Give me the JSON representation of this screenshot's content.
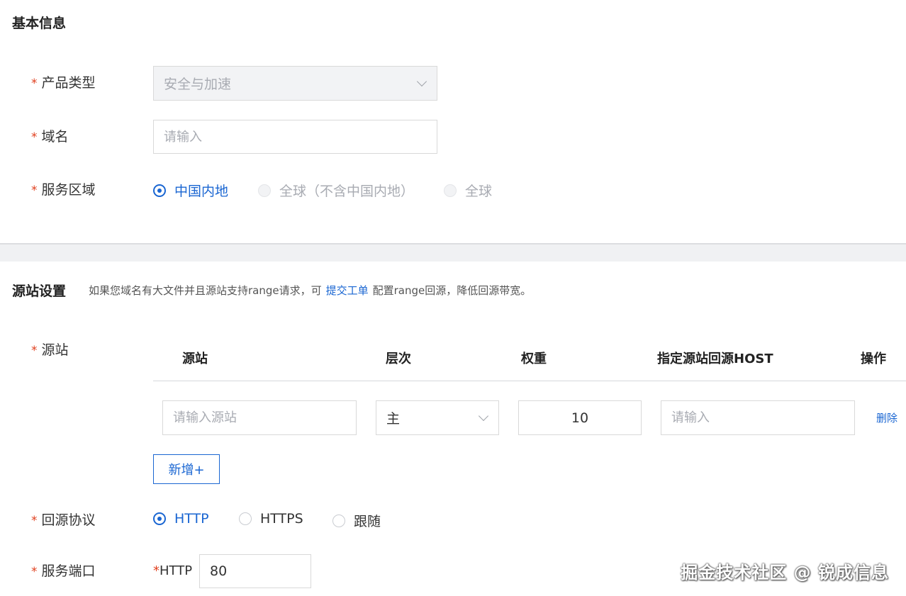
{
  "basic": {
    "title": "基本信息",
    "product_type": {
      "label": "产品类型",
      "value": "安全与加速"
    },
    "domain": {
      "label": "域名",
      "placeholder": "请输入"
    },
    "region": {
      "label": "服务区域",
      "options": [
        "中国内地",
        "全球（不含中国内地）",
        "全球"
      ],
      "selected": "中国内地"
    }
  },
  "origin": {
    "title": "源站设置",
    "hint_before": "如果您域名有大文件并且源站支持range请求，可",
    "hint_link": "提交工单",
    "hint_after": "配置range回源，降低回源带宽。",
    "label": "源站",
    "columns": [
      "源站",
      "层次",
      "权重",
      "指定源站回源HOST",
      "操作"
    ],
    "row": {
      "origin_placeholder": "请输入源站",
      "level": "主",
      "weight": "10",
      "host_placeholder": "请输入",
      "delete": "删除"
    },
    "add_button": "新增+"
  },
  "protocol": {
    "label": "回源协议",
    "options": [
      "HTTP",
      "HTTPS",
      "跟随"
    ],
    "selected": "HTTP"
  },
  "port": {
    "label": "服务端口",
    "prefix": "HTTP",
    "value": "80"
  },
  "watermark": "掘金技术社区 @ 锐成信息",
  "colors": {
    "primary": "#1a66d2",
    "required": "#e0401f"
  }
}
